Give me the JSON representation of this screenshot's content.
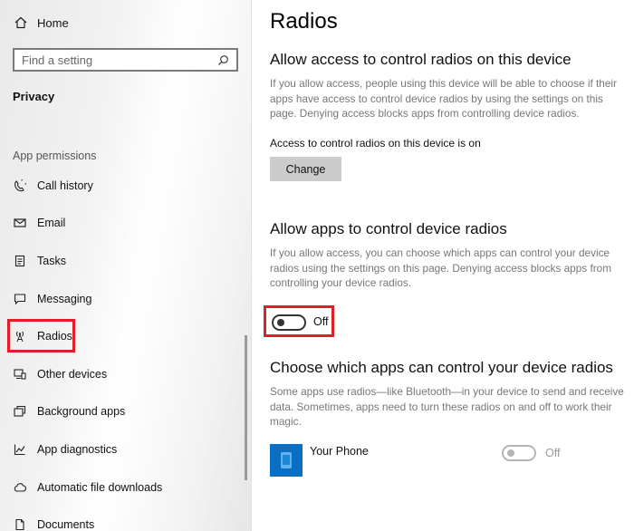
{
  "sidebar": {
    "home_label": "Home",
    "search_placeholder": "Find a setting",
    "section_title": "Privacy",
    "group_title": "App permissions",
    "items": [
      {
        "label": "Call history",
        "icon": "call-history-icon"
      },
      {
        "label": "Email",
        "icon": "email-icon"
      },
      {
        "label": "Tasks",
        "icon": "tasks-icon"
      },
      {
        "label": "Messaging",
        "icon": "messaging-icon"
      },
      {
        "label": "Radios",
        "icon": "radio-tower-icon",
        "active": true
      },
      {
        "label": "Other devices",
        "icon": "other-devices-icon"
      },
      {
        "label": "Background apps",
        "icon": "background-apps-icon"
      },
      {
        "label": "App diagnostics",
        "icon": "app-diagnostics-icon"
      },
      {
        "label": "Automatic file downloads",
        "icon": "cloud-download-icon"
      },
      {
        "label": "Documents",
        "icon": "document-icon"
      }
    ]
  },
  "main": {
    "title": "Radios",
    "section1": {
      "heading": "Allow access to control radios on this device",
      "description": "If you allow access, people using this device will be able to choose if their apps have access to control device radios by using the settings on this page. Denying access blocks apps from controlling device radios.",
      "status": "Access to control radios on this device is on",
      "button_label": "Change"
    },
    "section2": {
      "heading": "Allow apps to control device radios",
      "description": "If you allow access, you can choose which apps can control your device radios using the settings on this page. Denying access blocks apps from controlling your device radios.",
      "toggle_label": "Off"
    },
    "section3": {
      "heading": "Choose which apps can control your device radios",
      "description": "Some apps use radios—like Bluetooth—in your device to send and receive data. Sometimes, apps need to turn these radios on and off to work their magic.",
      "apps": [
        {
          "name": "Your Phone",
          "toggle_label": "Off"
        }
      ]
    }
  },
  "colors": {
    "highlight": "#e11d2a",
    "app_icon_bg": "#0a6fc2",
    "button_bg": "#cccccc"
  }
}
